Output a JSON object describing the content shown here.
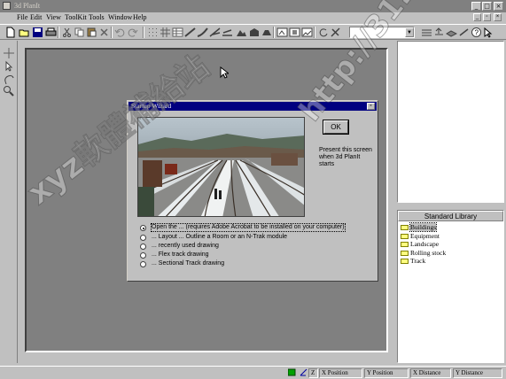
{
  "window": {
    "title": "3d PlanIt",
    "icon": "app-icon",
    "controls": [
      "minimize",
      "maximize",
      "close"
    ]
  },
  "menu": {
    "items": [
      "File",
      "Edit",
      "View",
      "ToolKit",
      "Tools",
      "Window",
      "Help"
    ]
  },
  "toolbar": {
    "layer_select_value": ""
  },
  "library": {
    "title": "Standard Library",
    "items": [
      {
        "label": "Buildings",
        "selected": true
      },
      {
        "label": "Equipment",
        "selected": false
      },
      {
        "label": "Landscape",
        "selected": false
      },
      {
        "label": "Rolling stock",
        "selected": false
      },
      {
        "label": "Track",
        "selected": false
      }
    ]
  },
  "statusbar": {
    "z_label": "Z",
    "x_position": "X Position",
    "y_position": "Y Position",
    "x_distance": "X Distance",
    "y_distance": "Y Distance"
  },
  "wizard": {
    "title": "Startup Wizard",
    "ok_label": "OK",
    "side_note": "Present this screen when 3d PlanIt starts",
    "options": [
      {
        "label": "Open the ... (requires Adobe Acrobat to be installed on your computer)",
        "selected": true
      },
      {
        "label": "... Layout ... Outline a Room or an N-Trak module",
        "selected": false
      },
      {
        "label": "... recently used drawing",
        "selected": false
      },
      {
        "label": "... Flex track drawing",
        "selected": false
      },
      {
        "label": "... Sectional Track drawing",
        "selected": false
      }
    ]
  },
  "watermark": {
    "left_text": "xyz軟體補給站",
    "right_text": "http://31.to"
  },
  "colors": {
    "title_active": "#000080",
    "title_inactive": "#808080",
    "face": "#c0c0c0",
    "canvas": "#808080",
    "folder": "#ffff80"
  }
}
